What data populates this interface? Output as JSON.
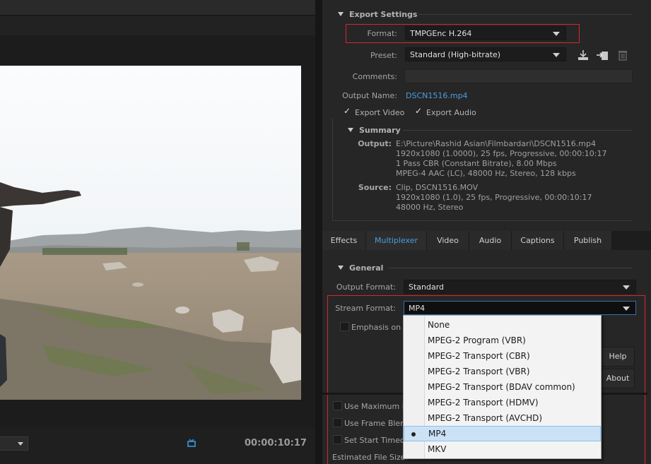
{
  "preview": {
    "timecode": "00:00:10:17"
  },
  "export_settings": {
    "heading": "Export Settings",
    "format_label": "Format:",
    "format_value": "TMPGEnc H.264",
    "preset_label": "Preset:",
    "preset_value": "Standard (High-bitrate)",
    "comments_label": "Comments:",
    "comments_value": "",
    "output_name_label": "Output Name:",
    "output_name_value": "DSCN1516.mp4",
    "export_video_label": "Export Video",
    "export_video_checked": true,
    "export_audio_label": "Export Audio",
    "export_audio_checked": true
  },
  "summary": {
    "heading": "Summary",
    "output_label": "Output:",
    "output_lines": [
      "E:\\Picture\\Rashid Asian\\Filmbardari\\DSCN1516.mp4",
      "1920x1080 (1.0000), 25 fps, Progressive, 00:00:10:17",
      "1 Pass CBR (Constant Bitrate), 8.00 Mbps",
      "MPEG-4 AAC (LC), 48000 Hz, Stereo, 128 kbps"
    ],
    "source_label": "Source:",
    "source_lines": [
      "Clip, DSCN1516.MOV",
      "1920x1080 (1.0), 25 fps, Progressive, 00:00:10:17",
      "48000 Hz, Stereo"
    ]
  },
  "tabs": [
    {
      "label": "Effects",
      "active": false
    },
    {
      "label": "Multiplexer",
      "active": true
    },
    {
      "label": "Video",
      "active": false
    },
    {
      "label": "Audio",
      "active": false
    },
    {
      "label": "Captions",
      "active": false
    },
    {
      "label": "Publish",
      "active": false
    }
  ],
  "general": {
    "heading": "General",
    "output_format_label": "Output Format:",
    "output_format_value": "Standard",
    "stream_format_label": "Stream Format:",
    "stream_format_value": "MP4",
    "emphasis_label": "Emphasis on p",
    "help_label": "Help",
    "about_label": "About"
  },
  "bottom_options": {
    "use_max_render_label": "Use Maximum Re",
    "use_frame_blending_label": "Use Frame Blend",
    "set_start_timecode_label": "Set Start Timeco",
    "estimated_size_label": "Estimated File Size:"
  },
  "stream_format_options": [
    {
      "label": "None",
      "selected": false
    },
    {
      "label": "MPEG-2 Program (VBR)",
      "selected": false
    },
    {
      "label": "MPEG-2 Transport (CBR)",
      "selected": false
    },
    {
      "label": "MPEG-2 Transport (VBR)",
      "selected": false
    },
    {
      "label": "MPEG-2 Transport (BDAV common)",
      "selected": false
    },
    {
      "label": "MPEG-2 Transport (HDMV)",
      "selected": false
    },
    {
      "label": "MPEG-2 Transport (AVCHD)",
      "selected": false
    },
    {
      "label": "MP4",
      "selected": true
    },
    {
      "label": "MKV",
      "selected": false
    }
  ],
  "colors": {
    "accent": "#4a9ede",
    "highlight_box": "#d9262b",
    "selection": "#cbe2f6"
  }
}
